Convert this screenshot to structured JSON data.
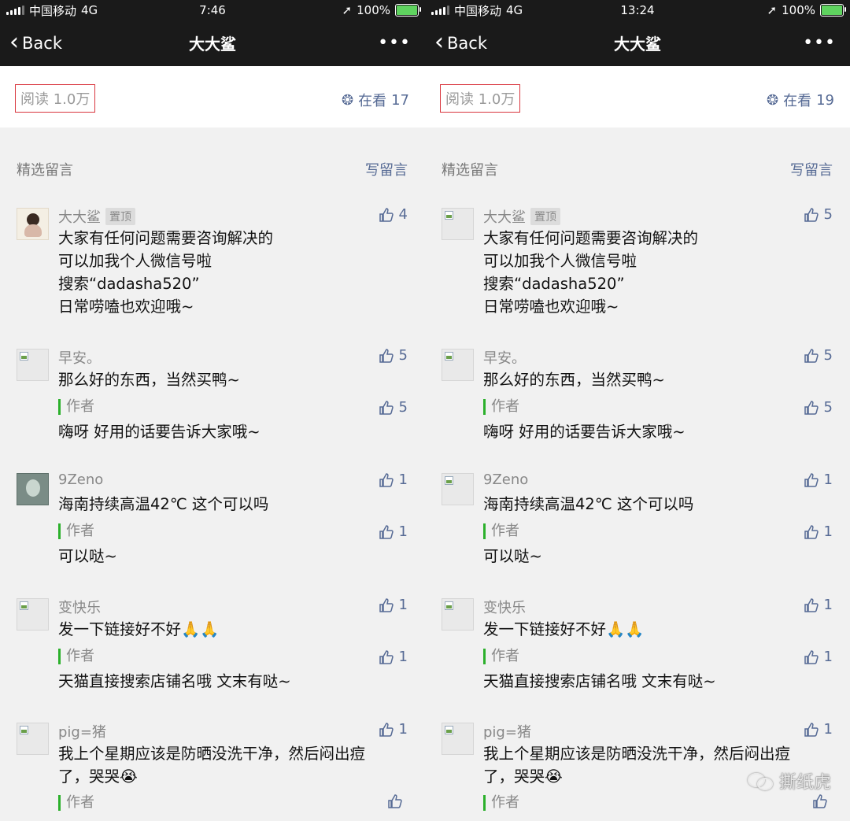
{
  "panels": [
    {
      "status": {
        "carrier": "中国移动",
        "network": "4G",
        "time": "7:46",
        "battery": "100%"
      },
      "nav": {
        "back": "Back",
        "title": "大大鲨",
        "more": "•••"
      },
      "read_bar": {
        "read": "阅读 1.0万",
        "watch_label": "在看",
        "watch_count": "17"
      },
      "section": {
        "title": "精选留言",
        "write": "写留言"
      },
      "comments": [
        {
          "nick": "大大鲨",
          "badge": "置顶",
          "likes": "4",
          "lines": [
            "大家有任何问题需要咨询解决的",
            "可以加我个人微信号啦",
            "搜索“dadasha520”",
            "日常唠嗑也欢迎哦~"
          ]
        },
        {
          "nick": "早安。",
          "likes": "5",
          "lines": [
            "那么好的东西，当然买鸭~"
          ],
          "reply_label": "作者",
          "reply_likes": "5",
          "reply": "嗨呀 好用的话要告诉大家哦~"
        },
        {
          "nick": "9Zeno",
          "likes": "1",
          "lines": [
            "海南持续高温42℃  这个可以吗"
          ],
          "reply_label": "作者",
          "reply_likes": "1",
          "reply": "可以哒~"
        },
        {
          "nick": "变快乐",
          "likes": "1",
          "lines": [
            "发一下链接好不好🙏🙏"
          ],
          "reply_label": "作者",
          "reply_likes": "1",
          "reply": "天猫直接搜索店铺名哦 文末有哒~"
        },
        {
          "nick": "pig=猪",
          "likes": "1",
          "lines": [
            "我上个星期应该是防晒没洗干净，然后闷出痘",
            "了，哭哭😭"
          ],
          "reply_label": "作者",
          "reply_likes": ""
        }
      ]
    },
    {
      "status": {
        "carrier": "中国移动",
        "network": "4G",
        "time": "13:24",
        "battery": "100%"
      },
      "nav": {
        "back": "Back",
        "title": "大大鲨",
        "more": "•••"
      },
      "read_bar": {
        "read": "阅读 1.0万",
        "watch_label": "在看",
        "watch_count": "19"
      },
      "section": {
        "title": "精选留言",
        "write": "写留言"
      },
      "comments": [
        {
          "nick": "大大鲨",
          "badge": "置顶",
          "likes": "5",
          "lines": [
            "大家有任何问题需要咨询解决的",
            "可以加我个人微信号啦",
            "搜索“dadasha520”",
            "日常唠嗑也欢迎哦~"
          ]
        },
        {
          "nick": "早安。",
          "likes": "5",
          "lines": [
            "那么好的东西，当然买鸭~"
          ],
          "reply_label": "作者",
          "reply_likes": "5",
          "reply": "嗨呀 好用的话要告诉大家哦~"
        },
        {
          "nick": "9Zeno",
          "likes": "1",
          "lines": [
            "海南持续高温42℃  这个可以吗"
          ],
          "reply_label": "作者",
          "reply_likes": "1",
          "reply": "可以哒~"
        },
        {
          "nick": "变快乐",
          "likes": "1",
          "lines": [
            "发一下链接好不好🙏🙏"
          ],
          "reply_label": "作者",
          "reply_likes": "1",
          "reply": "天猫直接搜索店铺名哦 文末有哒~"
        },
        {
          "nick": "pig=猪",
          "likes": "1",
          "lines": [
            "我上个星期应该是防晒没洗干净，然后闷出痘",
            "了，哭哭😭"
          ],
          "reply_label": "作者",
          "reply_likes": ""
        }
      ]
    }
  ],
  "watermark": "撕纸虎",
  "colors": {
    "link": "#576b95",
    "highlight_box": "#d9363e",
    "author_bar": "#2bb02b",
    "header_bg": "#1a1a1a"
  }
}
